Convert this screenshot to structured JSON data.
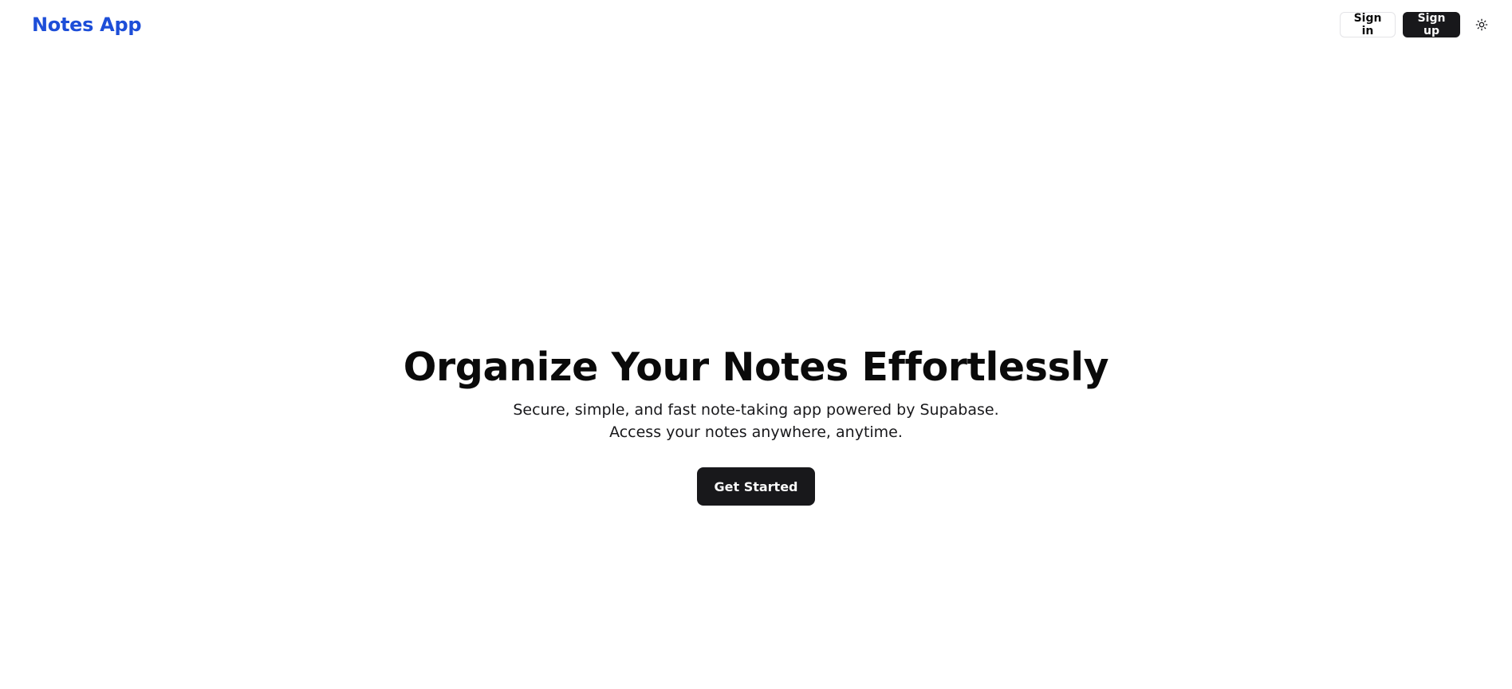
{
  "header": {
    "brand": "Notes App",
    "sign_in_label": "Sign in",
    "sign_up_label": "Sign up",
    "theme_toggle_icon": "sun-icon"
  },
  "hero": {
    "title": "Organize Your Notes Effortlessly",
    "subtitle_line1": "Secure, simple, and fast note-taking app powered by Supabase.",
    "subtitle_line2": "Access your notes anywhere, anytime.",
    "cta_label": "Get Started"
  },
  "colors": {
    "brand": "#1d4ed8",
    "primary_button": "#18181b",
    "background": "#ffffff",
    "text": "#0a0a0a",
    "border": "#e4e4e7"
  }
}
